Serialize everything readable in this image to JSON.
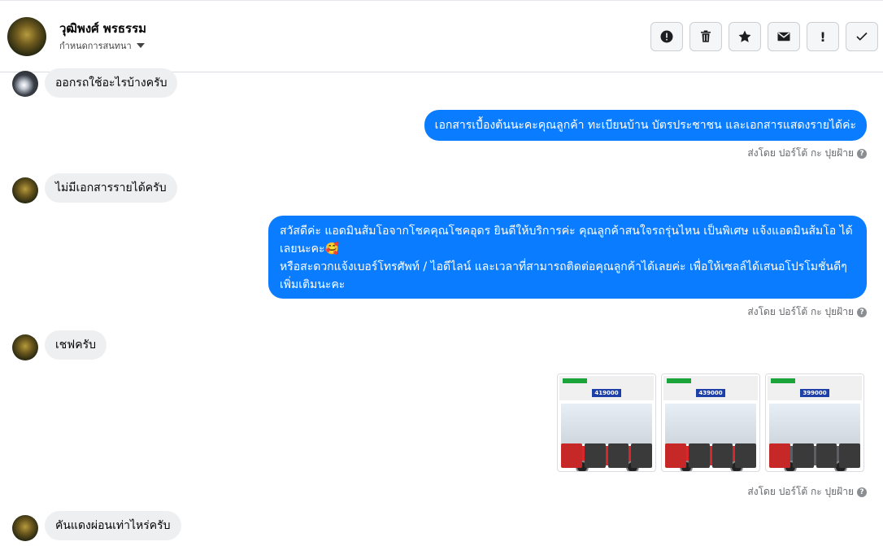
{
  "header": {
    "name": "วุฒิพงศ์ พรธรรม",
    "subtitle": "กำหนดการสนทนา",
    "actions": [
      {
        "name": "report-icon",
        "label": ""
      },
      {
        "name": "trash-icon",
        "label": ""
      },
      {
        "name": "star-icon",
        "label": ""
      },
      {
        "name": "mail-icon",
        "label": ""
      },
      {
        "name": "exclamation-icon",
        "label": "!"
      },
      {
        "name": "check-icon",
        "label": ""
      }
    ]
  },
  "messages": {
    "m1": "ออกรถใช้อะไรบ้างครับ",
    "m2": "เอกสารเบื้องต้นนะคะคุณลูกค้า ทะเบียนบ้าน บัตรประชาชน และเอกสารแสดงรายได้ค่ะ",
    "m3": "ไม่มีเอกสารรายได้ครับ",
    "m4_line1": "สวัสดีค่ะ แอดมินส้มโอจากโชคคุณโชคอุดร ยินดีให้บริการค่ะ   คุณลูกค้าสนใจรถรุ่นไหน เป็นพิเศษ แจ้งแอดมินส้มโอ ได้เลยนะคะ🥰",
    "m4_line2": "หรือสะดวกแจ้งเบอร์โทรศัพท์ / ไอดีไลน์ และเวลาที่สามารถติดต่อคุณลูกค้าได้เลยค่ะ เพื่อให้เซลล์ได้เสนอโปรโมชั่นดีๆเพิ่มเติมนะคะ",
    "m5": "เชฟครับ",
    "m6": "คันแดงผ่อนเท่าไหร่ครับ"
  },
  "sent_label": "ส่งโดย ปอร์โต้ กะ ปุยฝ้าย",
  "help_glyph": "?",
  "thumbnails": [
    {
      "price": "419000",
      "color": "#d9262a"
    },
    {
      "price": "439000",
      "color": "#d9262a"
    },
    {
      "price": "399000",
      "color": "#5b5e63"
    }
  ],
  "colors": {
    "accent": "#0a7cff",
    "incoming": "#eeeff1"
  }
}
